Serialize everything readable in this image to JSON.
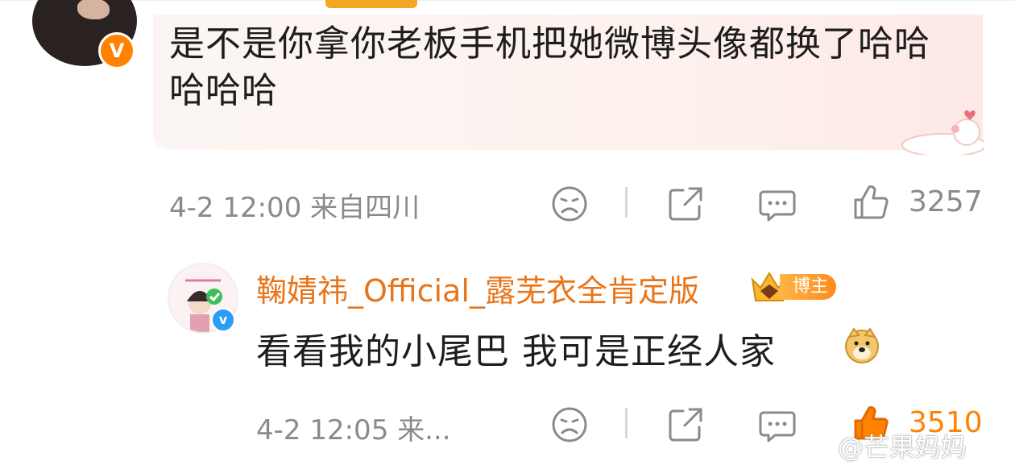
{
  "comment1": {
    "text": "是不是你拿你老板手机把她微博头像都换了哈哈哈哈哈",
    "verified_badge": "V",
    "meta": "4-2 12:00  来自四川",
    "like_count": "3257"
  },
  "comment2": {
    "username": "鞠婧祎_Official_露芜衣全肯定版",
    "badge_label": "博主",
    "verified_badge": "v",
    "text": "看看我的小尾巴 我可是正经人家",
    "meta": "4-2 12:05  来...",
    "like_count": "3510"
  },
  "icons": [
    "sad-face-icon",
    "share-icon",
    "comment-icon",
    "like-icon",
    "doge-emoji-icon",
    "crown-icon",
    "cat-sticker-icon"
  ],
  "colors": {
    "accent": "#ff8200",
    "username": "#e8751a",
    "meta": "#8a8a8a",
    "verified_blue": "#2a9df4"
  },
  "watermark": "@芒果妈妈"
}
